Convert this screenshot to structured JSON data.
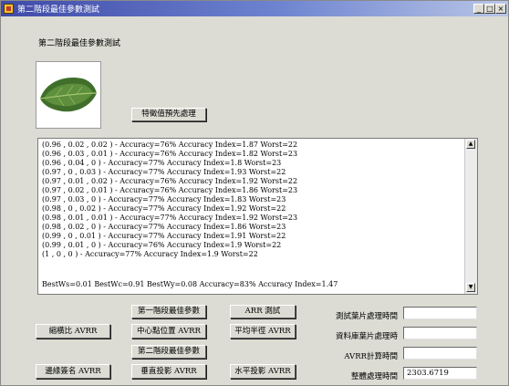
{
  "window": {
    "title": "第二階段最佳參數測試",
    "minimize": "_",
    "maximize": "□",
    "close": "×"
  },
  "header_label": "第二階段最佳參數測試",
  "buttons": {
    "feature_preprocess": "特徵值預先處理",
    "stage1_best_params": "第一階段最佳參數",
    "arr_test": "ARR 測試",
    "scale_avrr": "縮橫比 AVRR",
    "center_avrr": "中心點位置 AVRR",
    "avg_radius_avrr": "平均半徑 AVRR",
    "stage2_best_params": "第二階段最佳參數",
    "edge_sig_avrr": "邊緣簽名 AVRR",
    "vertical_proj_avrr": "垂直投影 AVRR",
    "horizontal_proj_avrr": "水平投影 AVRR"
  },
  "results_list": [
    "(0.96 , 0.02 , 0.02 ) - Accuracy=76%   Accuracy Index=1.87    Worst=22",
    "(0.96 , 0.03 , 0.01 ) - Accuracy=76%   Accuracy Index=1.82    Worst=23",
    "(0.96 , 0.04 , 0 ) - Accuracy=77%   Accuracy Index=1.8    Worst=23",
    "(0.97 , 0 , 0.03 ) - Accuracy=77%   Accuracy Index=1.93    Worst=22",
    "(0.97 , 0.01 , 0.02 ) - Accuracy=76%   Accuracy Index=1.92    Worst=22",
    "(0.97 , 0.02 , 0.01 ) - Accuracy=76%   Accuracy Index=1.86    Worst=23",
    "(0.97 , 0.03 , 0 ) - Accuracy=77%   Accuracy Index=1.83    Worst=23",
    "(0.98 , 0 , 0.02 ) - Accuracy=77%   Accuracy Index=1.92    Worst=22",
    "(0.98 , 0.01 , 0.01 ) - Accuracy=77%   Accuracy Index=1.92    Worst=23",
    "(0.98 , 0.02 , 0 ) - Accuracy=77%   Accuracy Index=1.86    Worst=23",
    "(0.99 , 0 , 0.01 ) - Accuracy=77%   Accuracy Index=1.91    Worst=22",
    "(0.99 , 0.01 , 0 ) - Accuracy=76%   Accuracy Index=1.9    Worst=22",
    "(1 , 0 , 0 ) - Accuracy=77%   Accuracy Index=1.9    Worst=22"
  ],
  "results_summary": "BestWs=0.01  BestWc=0.91  BestWy=0.08  Accuracy=83%    Accuracy Index=1.47",
  "timing": {
    "test_leaf_label": "測試葉片處理時間",
    "test_leaf_value": "",
    "db_leaf_label": "資料庫葉片處理時",
    "db_leaf_value": "",
    "avrr_calc_label": "AVRR計算時間",
    "avrr_calc_value": "",
    "total_label": "整體處理時間",
    "total_value": "2303.6719"
  }
}
